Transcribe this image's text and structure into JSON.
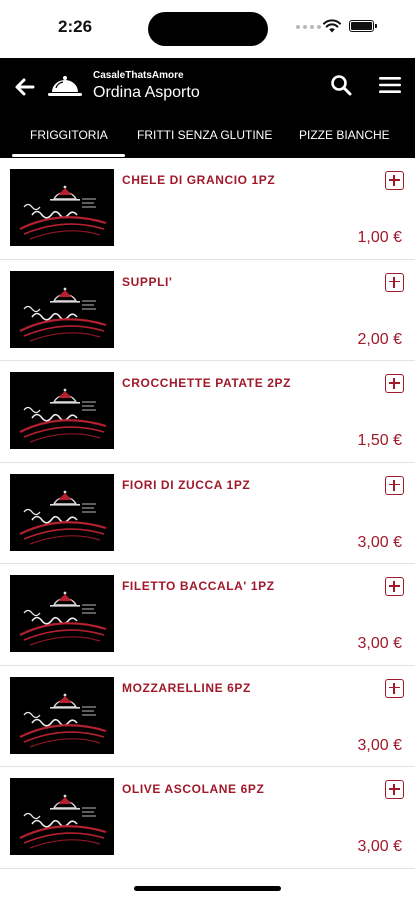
{
  "status_bar": {
    "time": "2:26"
  },
  "header": {
    "brand": "CasaleThatsAmore",
    "title": "Ordina Asporto"
  },
  "tabs": [
    {
      "label": "FRIGGITORIA",
      "active": true
    },
    {
      "label": "FRITTI SENZA GLUTINE",
      "active": false
    },
    {
      "label": "PIZZE BIANCHE",
      "active": false
    }
  ],
  "products": [
    {
      "name": "CHELE DI GRANCIO 1PZ",
      "price": "1,00 €"
    },
    {
      "name": "SUPPLI'",
      "price": "2,00 €"
    },
    {
      "name": "CROCCHETTE PATATE 2PZ",
      "price": "1,50 €"
    },
    {
      "name": "FIORI DI ZUCCA 1PZ",
      "price": "3,00 €"
    },
    {
      "name": "FILETTO BACCALA' 1PZ",
      "price": "3,00 €"
    },
    {
      "name": "MOZZARELLINE 6PZ",
      "price": "3,00 €"
    },
    {
      "name": "OLIVE ASCOLANE 6PZ",
      "price": "3,00 €"
    }
  ],
  "colors": {
    "accent": "#a0192a",
    "header_bg": "#000000",
    "background": "#ffffff"
  },
  "icons": {
    "back": "arrow-left-icon",
    "logo": "serving-cloche-icon",
    "search": "search-icon",
    "menu": "hamburger-menu-icon",
    "add": "plus-square-icon"
  }
}
